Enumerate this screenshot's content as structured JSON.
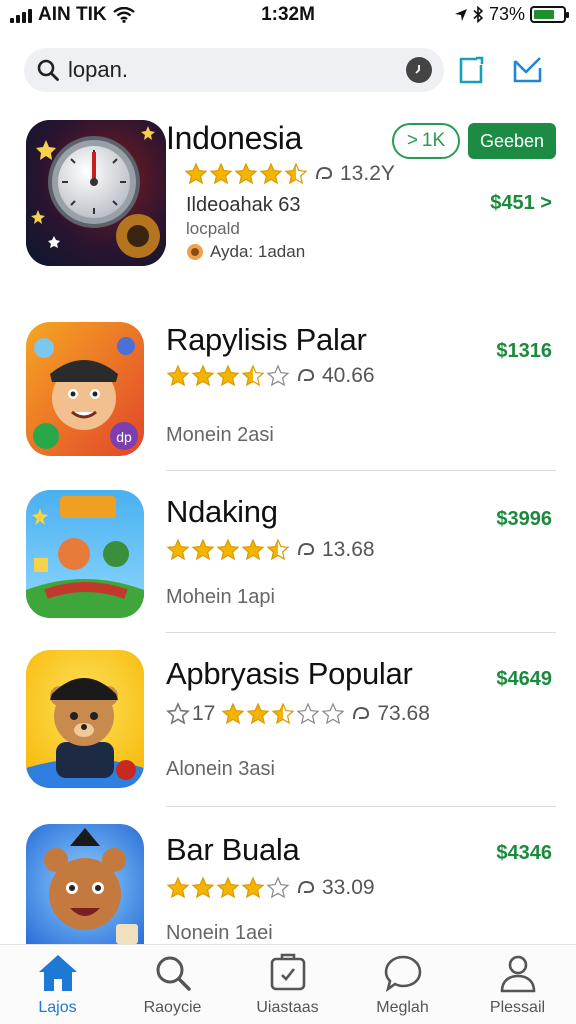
{
  "status": {
    "carrier": "AIN TIK",
    "time": "1:32M",
    "battery_percent": "73%",
    "battery_level": 0.73
  },
  "search": {
    "value": "lopan."
  },
  "featured": {
    "name": "Indonesia",
    "rating_value": 4.5,
    "reviews": "13.2Y",
    "subtitle": "Ildeoahak 63",
    "developer": "locpald",
    "tag": "Ayda: 1adan",
    "chip_label": "1K",
    "get_button_label": "Geeben",
    "price": "$451"
  },
  "apps": [
    {
      "name": "Rapylisis Palar",
      "rating_value": 3.5,
      "reviews": "40.66",
      "meta": "Monein 2asi",
      "price": "$1316"
    },
    {
      "name": "Ndaking",
      "rating_value": 4.5,
      "reviews": "13.68",
      "meta": "Mohein 1api",
      "price": "$3996"
    },
    {
      "name": "Apbryasis Popular",
      "rating_prefix": "17",
      "rating_value": 2.5,
      "reviews": "73.68",
      "meta": "Alonein 3asi",
      "price": "$4649"
    },
    {
      "name": "Bar Buala",
      "rating_value": 4.0,
      "reviews": "33.09",
      "meta": "Nonein 1aei",
      "price": "$4346"
    }
  ],
  "tabs": [
    {
      "label": "Lajos",
      "icon": "home-icon",
      "active": true
    },
    {
      "label": "Raoycie",
      "icon": "search-icon",
      "active": false
    },
    {
      "label": "Uiastaas",
      "icon": "apps-icon",
      "active": false
    },
    {
      "label": "Meglah",
      "icon": "chat-icon",
      "active": false
    },
    {
      "label": "Plessail",
      "icon": "profile-icon",
      "active": false
    }
  ],
  "colors": {
    "accent_green": "#1c8a3d",
    "tab_active": "#1e78d6",
    "star": "#f5b400"
  }
}
